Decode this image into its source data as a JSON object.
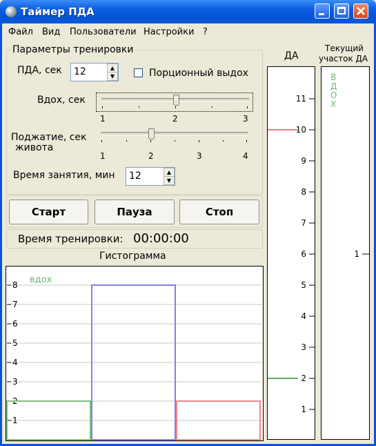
{
  "window": {
    "title": "Таймер ПДА"
  },
  "menu": [
    "Файл",
    "Вид",
    "Пользователи",
    "Настройки",
    "?"
  ],
  "params": {
    "group_label": "Параметры тренировки",
    "pda_label": "ПДА, сек",
    "pda_value": "12",
    "portion_label": "Порционный выдох",
    "portion_checked": false,
    "inhale_label": "Вдох, сек",
    "inhale_ticks": [
      "1",
      "2",
      "3"
    ],
    "inhale_value": 2,
    "press_label_line1": "Поджатие, сек",
    "press_label_line2": "живота",
    "press_ticks": [
      "1",
      "2",
      "3",
      "4"
    ],
    "press_value": 2,
    "session_label": "Время занятия, мин",
    "session_value": "12"
  },
  "controls": {
    "start": "Старт",
    "pause": "Пауза",
    "stop": "Стоп"
  },
  "training_time": {
    "label": "Время тренировки:",
    "value": "00:00:00"
  },
  "histogram": {
    "title": "Гистограмма",
    "phase_label": "вдох",
    "y_ticks": [
      "1",
      "2",
      "3",
      "4",
      "5",
      "6",
      "7",
      "8"
    ],
    "bars": [
      {
        "value": 2,
        "color": "#7fbf7f"
      },
      {
        "value": 8,
        "color": "#8080ee"
      },
      {
        "value": 2,
        "color": "#ee8888"
      }
    ]
  },
  "da_scale": {
    "title": "ДА",
    "ticks": [
      "1",
      "2",
      "3",
      "4",
      "5",
      "6",
      "7",
      "8",
      "9",
      "10",
      "11"
    ],
    "marker_high": 10,
    "marker_low": 2,
    "marker_high_color": "#e08080",
    "marker_low_color": "#60b060"
  },
  "current_segment": {
    "title_line1": "Текущий",
    "title_line2": "участок ДА",
    "phase_vertical": "вдох",
    "tick": "1",
    "phase_color": "#70b870"
  }
}
